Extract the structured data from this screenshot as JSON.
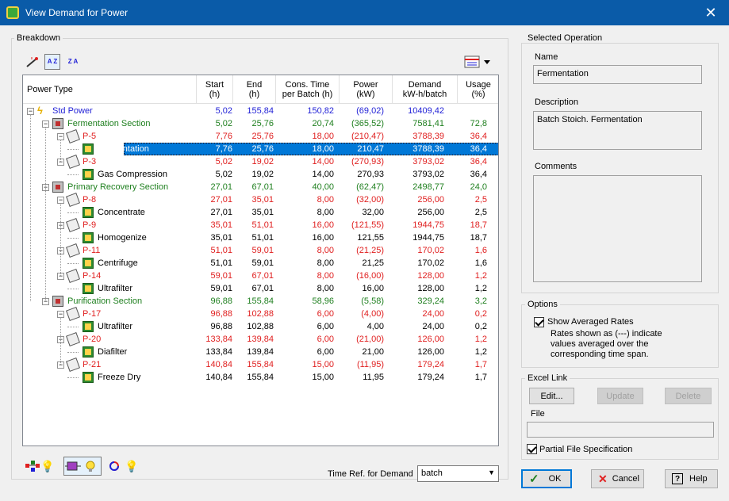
{
  "window": {
    "title": "View Demand for Power",
    "close_glyph": "✕"
  },
  "breakdown": {
    "label": "Breakdown"
  },
  "toolbar": {
    "sort_asc_label": "A Z",
    "sort_desc_label": "Z A"
  },
  "columns": [
    {
      "l1": "Power Type",
      "l2": ""
    },
    {
      "l1": "Start",
      "l2": "(h)"
    },
    {
      "l1": "End",
      "l2": "(h)"
    },
    {
      "l1": "Cons. Time",
      "l2": "per Batch (h)"
    },
    {
      "l1": "Power",
      "l2": "(kW)"
    },
    {
      "l1": "Demand",
      "l2": "kW-h/batch"
    },
    {
      "l1": "Usage",
      "l2": "(%)"
    }
  ],
  "rows": [
    {
      "level": 0,
      "kind": "power",
      "name": "Std Power",
      "color": "blue",
      "exp": "−",
      "start": "5,02",
      "end": "155,84",
      "cons": "150,82",
      "power": "(69,02)",
      "demand": "10409,42",
      "usage": ""
    },
    {
      "level": 1,
      "kind": "section",
      "name": "Fermentation Section",
      "color": "green",
      "exp": "−",
      "start": "5,02",
      "end": "25,76",
      "cons": "20,74",
      "power": "(365,52)",
      "demand": "7581,41",
      "usage": "72,8"
    },
    {
      "level": 2,
      "kind": "proc",
      "name": "P-5",
      "color": "red",
      "exp": "−",
      "start": "7,76",
      "end": "25,76",
      "cons": "18,00",
      "power": "(210,47)",
      "demand": "3788,39",
      "usage": "36,4"
    },
    {
      "level": 3,
      "kind": "op",
      "name": "Fermentation",
      "color": "black",
      "exp": "",
      "start": "7,76",
      "end": "25,76",
      "cons": "18,00",
      "power": "210,47",
      "demand": "3788,39",
      "usage": "36,4",
      "selected": true
    },
    {
      "level": 2,
      "kind": "proc",
      "name": "P-3",
      "color": "red",
      "exp": "−",
      "start": "5,02",
      "end": "19,02",
      "cons": "14,00",
      "power": "(270,93)",
      "demand": "3793,02",
      "usage": "36,4"
    },
    {
      "level": 3,
      "kind": "op",
      "name": "Gas Compression",
      "color": "black",
      "exp": "",
      "start": "5,02",
      "end": "19,02",
      "cons": "14,00",
      "power": "270,93",
      "demand": "3793,02",
      "usage": "36,4"
    },
    {
      "level": 1,
      "kind": "section",
      "name": "Primary Recovery Section",
      "color": "green",
      "exp": "−",
      "start": "27,01",
      "end": "67,01",
      "cons": "40,00",
      "power": "(62,47)",
      "demand": "2498,77",
      "usage": "24,0"
    },
    {
      "level": 2,
      "kind": "proc",
      "name": "P-8",
      "color": "red",
      "exp": "−",
      "start": "27,01",
      "end": "35,01",
      "cons": "8,00",
      "power": "(32,00)",
      "demand": "256,00",
      "usage": "2,5"
    },
    {
      "level": 3,
      "kind": "op",
      "name": "Concentrate",
      "color": "black",
      "exp": "",
      "start": "27,01",
      "end": "35,01",
      "cons": "8,00",
      "power": "32,00",
      "demand": "256,00",
      "usage": "2,5"
    },
    {
      "level": 2,
      "kind": "proc",
      "name": "P-9",
      "color": "red",
      "exp": "−",
      "start": "35,01",
      "end": "51,01",
      "cons": "16,00",
      "power": "(121,55)",
      "demand": "1944,75",
      "usage": "18,7"
    },
    {
      "level": 3,
      "kind": "op",
      "name": "Homogenize",
      "color": "black",
      "exp": "",
      "start": "35,01",
      "end": "51,01",
      "cons": "16,00",
      "power": "121,55",
      "demand": "1944,75",
      "usage": "18,7"
    },
    {
      "level": 2,
      "kind": "proc",
      "name": "P-11",
      "color": "red",
      "exp": "−",
      "start": "51,01",
      "end": "59,01",
      "cons": "8,00",
      "power": "(21,25)",
      "demand": "170,02",
      "usage": "1,6"
    },
    {
      "level": 3,
      "kind": "op",
      "name": "Centrifuge",
      "color": "black",
      "exp": "",
      "start": "51,01",
      "end": "59,01",
      "cons": "8,00",
      "power": "21,25",
      "demand": "170,02",
      "usage": "1,6"
    },
    {
      "level": 2,
      "kind": "proc",
      "name": "P-14",
      "color": "red",
      "exp": "−",
      "start": "59,01",
      "end": "67,01",
      "cons": "8,00",
      "power": "(16,00)",
      "demand": "128,00",
      "usage": "1,2"
    },
    {
      "level": 3,
      "kind": "op",
      "name": "Ultrafilter",
      "color": "black",
      "exp": "",
      "start": "59,01",
      "end": "67,01",
      "cons": "8,00",
      "power": "16,00",
      "demand": "128,00",
      "usage": "1,2"
    },
    {
      "level": 1,
      "kind": "section",
      "name": "Purification Section",
      "color": "green",
      "exp": "−",
      "start": "96,88",
      "end": "155,84",
      "cons": "58,96",
      "power": "(5,58)",
      "demand": "329,24",
      "usage": "3,2"
    },
    {
      "level": 2,
      "kind": "proc",
      "name": "P-17",
      "color": "red",
      "exp": "−",
      "start": "96,88",
      "end": "102,88",
      "cons": "6,00",
      "power": "(4,00)",
      "demand": "24,00",
      "usage": "0,2"
    },
    {
      "level": 3,
      "kind": "op",
      "name": "Ultrafilter",
      "color": "black",
      "exp": "",
      "start": "96,88",
      "end": "102,88",
      "cons": "6,00",
      "power": "4,00",
      "demand": "24,00",
      "usage": "0,2"
    },
    {
      "level": 2,
      "kind": "proc",
      "name": "P-20",
      "color": "red",
      "exp": "−",
      "start": "133,84",
      "end": "139,84",
      "cons": "6,00",
      "power": "(21,00)",
      "demand": "126,00",
      "usage": "1,2"
    },
    {
      "level": 3,
      "kind": "op",
      "name": "Diafilter",
      "color": "black",
      "exp": "",
      "start": "133,84",
      "end": "139,84",
      "cons": "6,00",
      "power": "21,00",
      "demand": "126,00",
      "usage": "1,2"
    },
    {
      "level": 2,
      "kind": "proc",
      "name": "P-21",
      "color": "red",
      "exp": "−",
      "start": "140,84",
      "end": "155,84",
      "cons": "15,00",
      "power": "(11,95)",
      "demand": "179,24",
      "usage": "1,7"
    },
    {
      "level": 3,
      "kind": "op",
      "name": "Freeze Dry",
      "color": "black",
      "exp": "",
      "start": "140,84",
      "end": "155,84",
      "cons": "15,00",
      "power": "11,95",
      "demand": "179,24",
      "usage": "1,7"
    }
  ],
  "time_ref": {
    "label": "Time Ref. for Demand",
    "value": "batch"
  },
  "selected_operation": {
    "group_label": "Selected Operation",
    "name_label": "Name",
    "name_value": "Fermentation",
    "description_label": "Description",
    "description_value": "Batch Stoich. Fermentation",
    "comments_label": "Comments",
    "comments_value": ""
  },
  "options": {
    "group_label": "Options",
    "show_averaged_label": "Show Averaged Rates",
    "show_averaged_note": "Rates shown as (---) indicate values averaged over the corresponding time span.",
    "show_averaged_checked": true
  },
  "excel_link": {
    "group_label": "Excel Link",
    "edit_label": "Edit...",
    "update_label": "Update",
    "delete_label": "Delete",
    "file_label": "File",
    "file_value": "",
    "partial_label": "Partial File Specification",
    "partial_checked": true
  },
  "buttons": {
    "ok": "OK",
    "cancel": "Cancel",
    "help": "Help"
  },
  "colors": {
    "titlebar": "#0a5ba8",
    "selection": "#0078d7",
    "blue": "#1f1fd6",
    "green": "#208020",
    "red": "#e02020"
  }
}
